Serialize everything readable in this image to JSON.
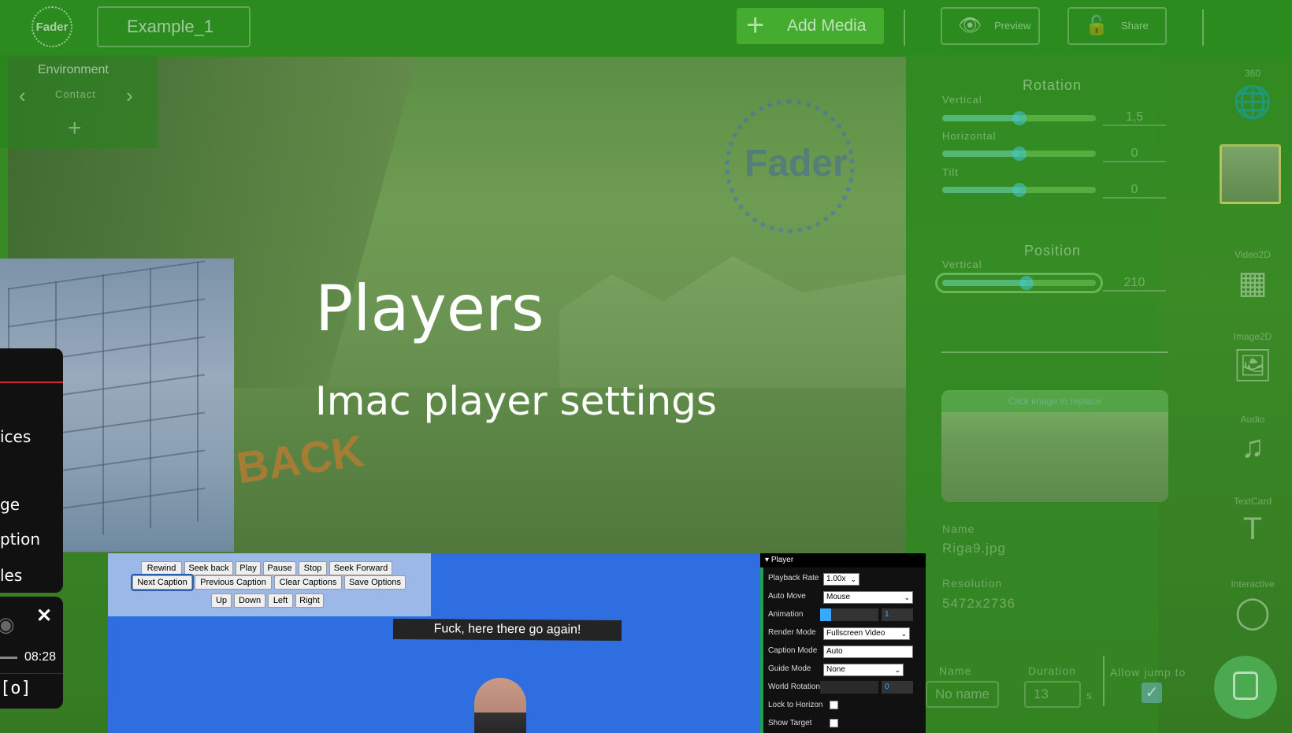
{
  "topbar": {
    "logo_text": "Fader",
    "project_name": "Example_1",
    "add_media_label": "Add Media",
    "preview_label": "Preview",
    "share_label": "Share"
  },
  "environment": {
    "title": "Environment",
    "current": "Contact"
  },
  "slide": {
    "title": "Players",
    "subtitle": "Imac player settings",
    "watermark_brand": "Fader",
    "back_text": "BACK"
  },
  "properties": {
    "rotation_title": "Rotation",
    "rotation": [
      {
        "label": "Vertical",
        "value": "1,5",
        "fraction": 0.5
      },
      {
        "label": "Horizontal",
        "value": "0",
        "fraction": 0.5
      },
      {
        "label": "Tilt",
        "value": "0",
        "fraction": 0.5
      }
    ],
    "position_title": "Position",
    "position": [
      {
        "label": "Vertical",
        "value": "210",
        "fraction": 0.55
      }
    ],
    "thumb_hint": "Click image to replace",
    "name_label": "Name",
    "name_value": "Riga9.jpg",
    "resolution_label": "Resolution",
    "resolution_value": "5472x2736"
  },
  "bottom_row": {
    "name_label": "Name",
    "name_placeholder": "No name",
    "duration_label": "Duration",
    "duration_value": "13",
    "duration_unit": "s",
    "allow_jump_label": "Allow jump to",
    "allow_jump_checked": true
  },
  "media_types": [
    {
      "label": "360",
      "icon": "globe-icon",
      "glyph": "🌐"
    },
    {
      "label": "Video2D",
      "icon": "film-icon",
      "glyph": "▦"
    },
    {
      "label": "Image2D",
      "icon": "image-icon",
      "glyph": "🖼"
    },
    {
      "label": "Audio",
      "icon": "music-note-icon",
      "glyph": "♫"
    },
    {
      "label": "TextCard",
      "icon": "text-icon",
      "glyph": "T"
    },
    {
      "label": "Interactive",
      "icon": "circle-icon",
      "glyph": "◯"
    }
  ],
  "left_menu": {
    "items": [
      "ices",
      "ge",
      "ption",
      "les"
    ],
    "time": "08:28",
    "close_glyph": "✕",
    "camera_glyph": "[o]"
  },
  "player": {
    "buttons_row1": [
      "Rewind",
      "Seek back",
      "Play",
      "Pause",
      "Stop",
      "Seek Forward"
    ],
    "buttons_row2": [
      "Next Caption",
      "Previous Caption",
      "Clear Captions",
      "Save Options"
    ],
    "buttons_row3": [
      "Up",
      "Down",
      "Left",
      "Right"
    ],
    "caption": "Fuck, here there go again!",
    "settings_header": "Player",
    "settings": {
      "playback_rate_label": "Playback Rate",
      "playback_rate_value": "1.00x",
      "auto_move_label": "Auto Move",
      "auto_move_value": "Mouse",
      "animation_label": "Animation",
      "animation_value": "1",
      "render_mode_label": "Render Mode",
      "render_mode_value": "Fullscreen Video",
      "caption_mode_label": "Caption Mode",
      "caption_mode_value": "Auto",
      "guide_mode_label": "Guide Mode",
      "guide_mode_value": "None",
      "world_rotation_label": "World Rotation",
      "world_rotation_value": "0",
      "lock_horizon_label": "Lock to Horizon",
      "show_target_label": "Show Target"
    }
  },
  "colors": {
    "overlay_green": "#2f8a1f",
    "player_blue": "#2f6ee0",
    "menu_accent_red": "#d0243c",
    "settings_accent_green": "#22a04a"
  }
}
